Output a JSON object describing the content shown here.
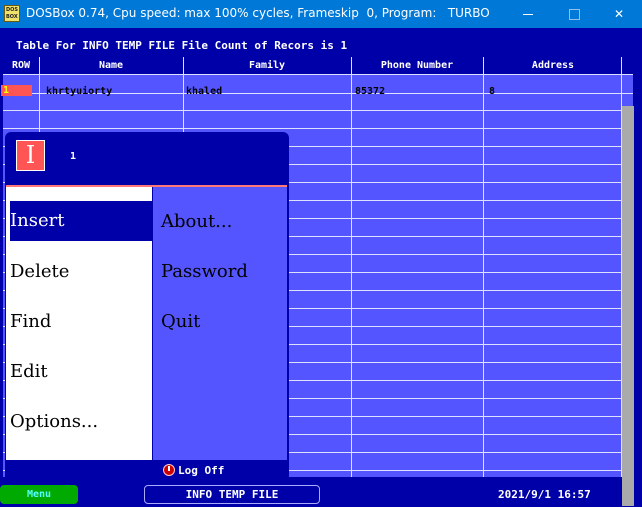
{
  "window": {
    "icon_text_top": "DOS",
    "icon_text_bottom": "BOX",
    "title": "DOSBox 0.74, Cpu speed: max 100% cycles, Frameskip  0, Program:   TURBO",
    "close_symbol": "✕"
  },
  "dos": {
    "table_title": "Table For INFO TEMP FILE File Count of Recors is 1",
    "columns": [
      "ROW",
      "Name",
      "Family",
      "Phone Number",
      "Address"
    ],
    "rows": [
      {
        "row": "1",
        "name": "khrtyuiorty",
        "family": "khaled",
        "phone": "85372",
        "address": "8"
      }
    ]
  },
  "menu": {
    "logo_letter": "I",
    "record_number": "1",
    "left_items": [
      "Insert",
      "Delete",
      "Find",
      "Edit",
      "Options..."
    ],
    "right_items": [
      "About...",
      "Password",
      "Quit"
    ],
    "logoff_label": "Log Off",
    "selected_item": "Insert"
  },
  "status_bar": {
    "menu_button": "Menu",
    "file_label": "INFO TEMP FILE",
    "datetime": "2021/9/1 16:57"
  },
  "colors": {
    "dos_blue": "#0000a8",
    "table_blue": "#5555ff",
    "title_bar": "#0078d7",
    "accent_red": "#ff5555",
    "menu_green": "#00aa00"
  }
}
